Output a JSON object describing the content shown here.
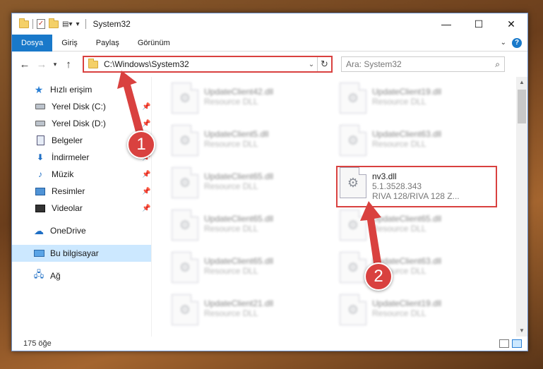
{
  "titlebar": {
    "title": "System32",
    "controls": [
      "—",
      "☐",
      "✕"
    ]
  },
  "ribbon": {
    "tabs": [
      "Dosya",
      "Giriş",
      "Paylaş",
      "Görünüm"
    ],
    "active_tab": "Dosya"
  },
  "address": {
    "path": "C:\\Windows\\System32",
    "search_placeholder": "Ara: System32"
  },
  "sidebar": {
    "quick_access": "Hızlı erişim",
    "items": [
      {
        "label": "Yerel Disk (C:)",
        "icon": "drive-icon"
      },
      {
        "label": "Yerel Disk (D:)",
        "icon": "drive-icon"
      },
      {
        "label": "Belgeler",
        "icon": "documents-icon"
      },
      {
        "label": "İndirmeler",
        "icon": "download-icon"
      },
      {
        "label": "Müzik",
        "icon": "music-icon"
      },
      {
        "label": "Resimler",
        "icon": "pictures-icon"
      },
      {
        "label": "Videolar",
        "icon": "videos-icon"
      }
    ],
    "onedrive": "OneDrive",
    "this_pc": "Bu bilgisayar",
    "network": "Ağ"
  },
  "files": {
    "left_col": [
      {
        "name": "UpdateClient42.dll",
        "sub": "Resource DLL"
      },
      {
        "name": "UpdateClient5.dll",
        "sub": "Resource DLL"
      },
      {
        "name": "UpdateClient65.dll",
        "sub": "Resource DLL"
      },
      {
        "name": "UpdateClient65.dll",
        "sub": "Resource DLL"
      },
      {
        "name": "UpdateClient65.dll",
        "sub": "Resource DLL"
      },
      {
        "name": "UpdateClient21.dll",
        "sub": "Resource DLL"
      }
    ],
    "right_col": [
      {
        "name": "UpdateClient19.dll",
        "sub": "Resource DLL"
      },
      {
        "name": "UpdateClient63.dll",
        "sub": "Resource DLL"
      },
      {
        "name": "UpdateClient65.dll",
        "sub": "Resource DLL"
      },
      {
        "name": "UpdateClient63.dll",
        "sub": "Resource DLL"
      },
      {
        "name": "UpdateClient19.dll",
        "sub": "Resource DLL"
      }
    ],
    "target": {
      "name": "nv3.dll",
      "version": "5.1.3528.343",
      "desc": "RIVA 128/RIVA 128 Z..."
    }
  },
  "status": {
    "count": "175 öğe"
  },
  "callouts": {
    "one": "1",
    "two": "2"
  },
  "colors": {
    "accent": "#1979ca",
    "highlight": "#d9413f"
  }
}
